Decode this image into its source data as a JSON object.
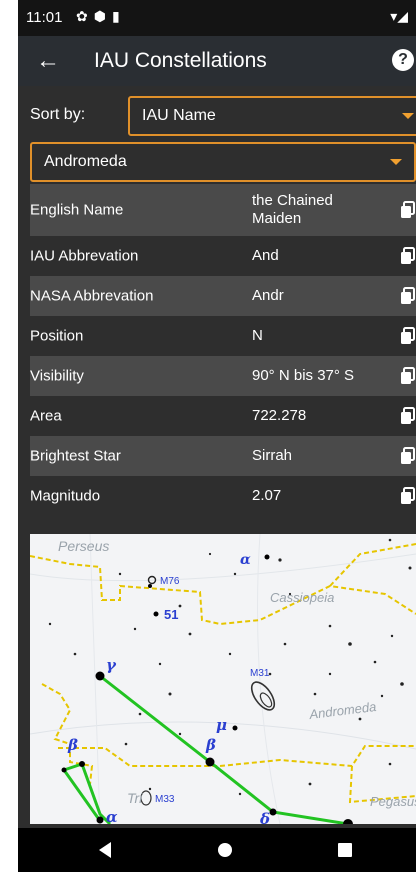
{
  "status": {
    "time": "11:01"
  },
  "appbar": {
    "title": "IAU Constellations",
    "back_icon": "arrow-back-icon",
    "help_icon": "help-circle-icon"
  },
  "sort": {
    "label": "Sort by:",
    "selected": "IAU Name"
  },
  "constellation": {
    "selected": "Andromeda"
  },
  "rows": [
    {
      "label": "English Name",
      "value": "the Chained Maiden"
    },
    {
      "label": "IAU Abbrevation",
      "value": "And"
    },
    {
      "label": "NASA Abbrevation",
      "value": "Andr"
    },
    {
      "label": "Position",
      "value": "N"
    },
    {
      "label": "Visibility",
      "value": "90° N bis 37° S"
    },
    {
      "label": "Area",
      "value": "722.278"
    },
    {
      "label": "Brightest Star",
      "value": "Sirrah"
    },
    {
      "label": "Magnitudo",
      "value": "2.07"
    }
  ],
  "map": {
    "constellation_labels": [
      "Perseus",
      "Cassiopeia",
      "Andromeda",
      "Tri",
      "Pegasus"
    ],
    "object_labels": [
      "M76",
      "M31",
      "M33",
      "51"
    ],
    "star_labels": [
      "γ",
      "β",
      "μ",
      "β",
      "α",
      "δ",
      "α"
    ],
    "colors": {
      "lines": "#22c322",
      "boundaries": "#e6c500",
      "labels": "#2a3fd0"
    }
  },
  "navbar": {
    "back_icon": "nav-back-icon",
    "home_icon": "nav-home-icon",
    "recents_icon": "nav-recents-icon"
  }
}
